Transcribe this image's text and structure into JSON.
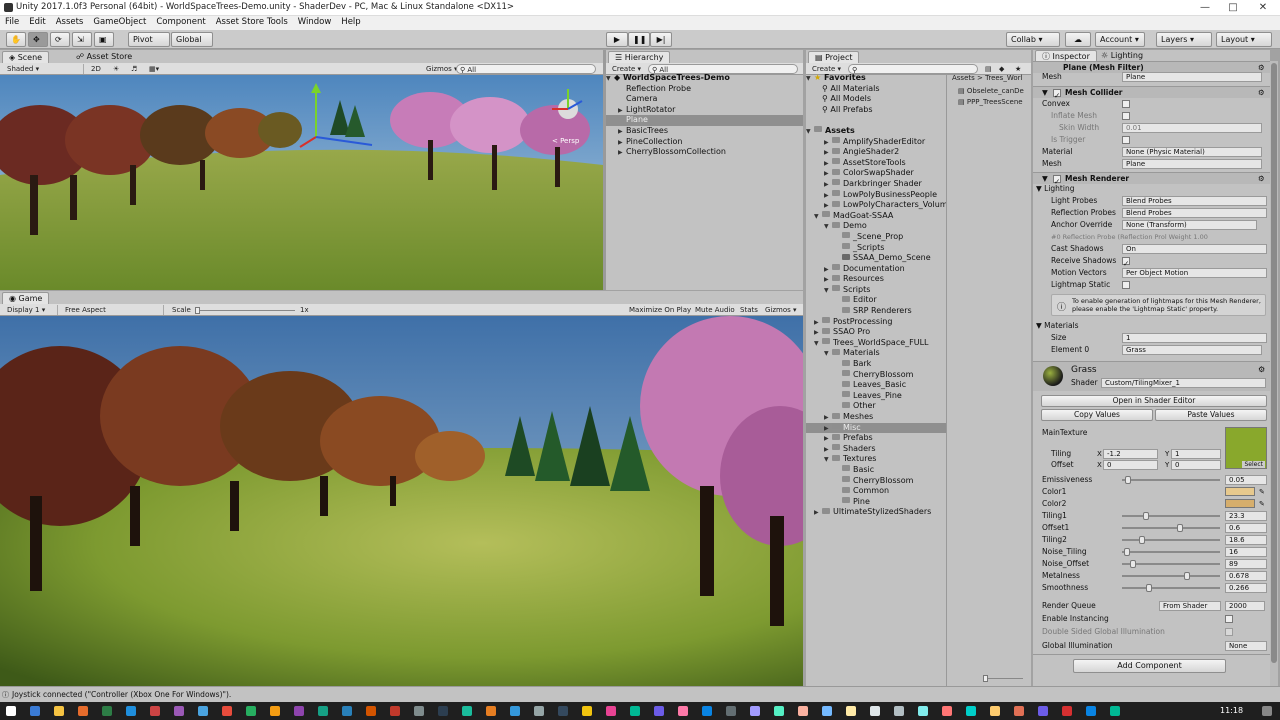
{
  "window": {
    "title": "Unity 2017.1.0f3 Personal (64bit) - WorldSpaceTrees-Demo.unity - ShaderDev - PC, Mac & Linux Standalone <DX11>"
  },
  "menu": [
    "File",
    "Edit",
    "Assets",
    "GameObject",
    "Component",
    "Asset Store Tools",
    "Window",
    "Help"
  ],
  "toolbar": {
    "pivot": "Pivot",
    "global": "Global",
    "collab": "Collab",
    "account": "Account",
    "layers": "Layers",
    "layout": "Layout",
    "play_icon": "play-icon",
    "pause_icon": "pause-icon",
    "step_icon": "step-icon"
  },
  "scene": {
    "tab": "Scene",
    "tab2": "Asset Store",
    "shading": "Shaded",
    "mode2d": "2D",
    "gizmos": "Gizmos",
    "search": "All",
    "persp": "< Persp"
  },
  "game": {
    "tab": "Game",
    "display": "Display 1",
    "aspect": "Free Aspect",
    "scale_label": "Scale",
    "scale_value": "1x",
    "maximize": "Maximize On Play",
    "mute": "Mute Audio",
    "stats": "Stats",
    "gizmos": "Gizmos"
  },
  "hierarchy": {
    "tab": "Hierarchy",
    "create": "Create",
    "search": "All",
    "root": "WorldSpaceTrees-Demo",
    "items": [
      "Reflection Probe",
      "Camera",
      "LightRotator",
      "Plane",
      "BasicTrees",
      "PineCollection",
      "CherryBlossomCollection"
    ]
  },
  "project": {
    "tab": "Project",
    "create": "Create",
    "favorites": "Favorites",
    "fav_items": [
      "All Materials",
      "All Models",
      "All Prefabs"
    ],
    "assets_label": "Assets",
    "tree": [
      "AmplifyShaderEditor",
      "AngieShader2",
      "AssetStoreTools",
      "ColorSwapShader",
      "Darkbringer Shader",
      "LowPolyBusinessPeople",
      "LowPolyCharacters_Volume",
      "MadGoat-SSAA",
      "Demo",
      "_Scene_Prop",
      "_Scripts",
      "SSAA_Demo_Scene",
      "Documentation",
      "Resources",
      "Scripts",
      "Editor",
      "SRP Renderers",
      "PostProcessing",
      "SSAO Pro",
      "Trees_WorldSpace_FULL",
      "Materials",
      "Bark",
      "CherryBlossom",
      "Leaves_Basic",
      "Leaves_Pine",
      "Other",
      "Meshes",
      "Misc",
      "Prefabs",
      "Shaders",
      "Textures",
      "Basic",
      "CherryBlossom",
      "Common",
      "Pine",
      "UltimateStylizedShaders"
    ],
    "breadcrumb": "Assets > Trees_Worl",
    "files": [
      "Obselete_canDe",
      "PPP_TreesScene"
    ]
  },
  "inspector": {
    "tab": "Inspector",
    "tab2": "Lighting",
    "mesh_filter": {
      "title": "Plane (Mesh Filter)",
      "mesh_label": "Mesh",
      "mesh_value": "Plane"
    },
    "mesh_collider": {
      "title": "Mesh Collider",
      "convex": "Convex",
      "inflate": "Inflate Mesh",
      "skin": "Skin Width",
      "skin_value": "0.01",
      "trigger": "Is Trigger",
      "material": "Material",
      "material_value": "None (Physic Material)",
      "mesh": "Mesh",
      "mesh_value": "Plane"
    },
    "mesh_renderer": {
      "title": "Mesh Renderer",
      "lighting": "Lighting",
      "light_probes": "Light Probes",
      "light_probes_value": "Blend Probes",
      "refl_probes": "Reflection Probes",
      "refl_probes_value": "Blend Probes",
      "anchor": "Anchor Override",
      "anchor_value": "None (Transform)",
      "probe_row": "#0     Reflection Probe (Reflection Prol  Weight 1.00",
      "cast": "Cast Shadows",
      "cast_value": "On",
      "receive": "Receive Shadows",
      "motion": "Motion Vectors",
      "motion_value": "Per Object Motion",
      "static": "Lightmap Static",
      "info": "To enable generation of lightmaps for this Mesh Renderer, please enable the 'Lightmap Static' property.",
      "materials": "Materials",
      "size": "Size",
      "size_value": "1",
      "element": "Element 0",
      "element_value": "Grass"
    },
    "material": {
      "name": "Grass",
      "shader_label": "Shader",
      "shader_value": "Custom/TilingMixer_1",
      "open_editor": "Open in Shader Editor",
      "copy": "Copy Values",
      "paste": "Paste Values",
      "main_texture": "MainTexture",
      "tiling": "Tiling",
      "offset": "Offset",
      "tiling_x": "-1.2",
      "tiling_y": "1",
      "offset_x": "0",
      "offset_y": "0",
      "select": "Select",
      "props": [
        {
          "label": "Emissiveness",
          "value": "0.05",
          "pos": 0.03
        },
        {
          "label": "Color1",
          "value": "",
          "color": "#e7c98d"
        },
        {
          "label": "Color2",
          "value": "",
          "color": "#d6ae6c"
        },
        {
          "label": "Tiling1",
          "value": "23.3",
          "pos": 0.23
        },
        {
          "label": "Offset1",
          "value": "0.6",
          "pos": 0.6
        },
        {
          "label": "Tiling2",
          "value": "18.6",
          "pos": 0.19
        },
        {
          "label": "Noise_Tiling",
          "value": "16",
          "pos": 0.02
        },
        {
          "label": "Noise_Offset",
          "value": "89",
          "pos": 0.09
        },
        {
          "label": "Metalness",
          "value": "0.678",
          "pos": 0.678
        },
        {
          "label": "Smoothness",
          "value": "0.266",
          "pos": 0.266
        }
      ],
      "render_queue": "Render Queue",
      "rq_mode": "From Shader",
      "rq_value": "2000",
      "instancing": "Enable Instancing",
      "double_sided": "Double Sided Global Illumination",
      "gi": "Global Illumination",
      "gi_value": "None"
    },
    "add_component": "Add Component"
  },
  "status": "Joystick connected (\"Controller (Xbox One For Windows)\").",
  "clock": "11:18",
  "colors": {
    "panel": "#c2c2c2",
    "selection": "#8f8f8f",
    "toolbar": "#cbcbcb"
  }
}
